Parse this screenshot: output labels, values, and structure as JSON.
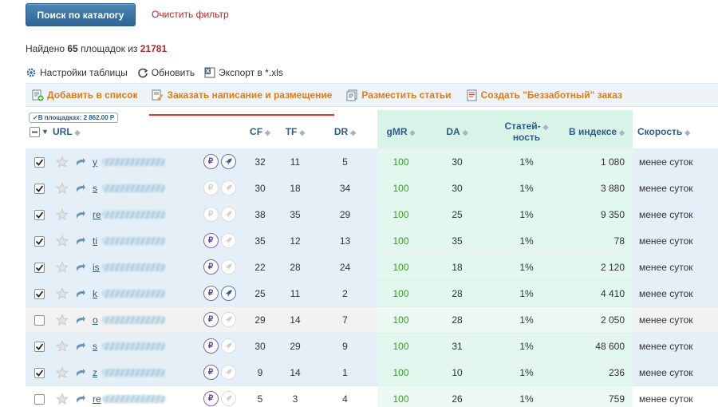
{
  "top": {
    "search_button": "Поиск по каталогу",
    "clear_filter": "Очистить фильтр"
  },
  "found": {
    "prefix": "Найдено",
    "count": "65",
    "middle": "площадок из",
    "total": "21781"
  },
  "tools": {
    "settings": "Настройки таблицы",
    "refresh": "Обновить",
    "export": "Экспорт в *.xls"
  },
  "actions": {
    "add_to_list": "Добавить в список",
    "order_writing": "Заказать написание и размещение",
    "place_articles": "Разместить статьи",
    "create_order": "Создать \"Беззаботный\" заказ"
  },
  "badge": "✓В площадках: 2 862.00 Р",
  "columns": {
    "url": "URL",
    "cf": "CF",
    "tf": "TF",
    "dr": "DR",
    "gmr": "gMR",
    "da": "DA",
    "articles_l1": "Статей-",
    "articles_l2": "ность",
    "index": "В индексе",
    "speed": "Скорость"
  },
  "rows": [
    {
      "checked": true,
      "prefix": "y",
      "ruble": "on",
      "rocket": "blue",
      "cf": "32",
      "tf": "11",
      "dr": "5",
      "gmr": "100",
      "da": "30",
      "st": "1%",
      "idx": "1 080",
      "speed": "менее суток"
    },
    {
      "checked": true,
      "prefix": "s",
      "ruble": "off",
      "rocket": "off",
      "cf": "30",
      "tf": "18",
      "dr": "34",
      "gmr": "100",
      "da": "30",
      "st": "1%",
      "idx": "3 880",
      "speed": "менее суток"
    },
    {
      "checked": true,
      "prefix": "re",
      "ruble": "off",
      "rocket": "off",
      "cf": "38",
      "tf": "35",
      "dr": "29",
      "gmr": "100",
      "da": "25",
      "st": "1%",
      "idx": "9 350",
      "speed": "менее суток"
    },
    {
      "checked": true,
      "prefix": "ti",
      "ruble": "on",
      "rocket": "off",
      "cf": "35",
      "tf": "12",
      "dr": "13",
      "gmr": "100",
      "da": "35",
      "st": "1%",
      "idx": "78",
      "speed": "менее суток"
    },
    {
      "checked": true,
      "prefix": "is",
      "ruble": "on",
      "rocket": "off",
      "cf": "22",
      "tf": "28",
      "dr": "24",
      "gmr": "100",
      "da": "18",
      "st": "1%",
      "idx": "2 120",
      "speed": "менее суток"
    },
    {
      "checked": true,
      "prefix": "k",
      "ruble": "on",
      "rocket": "blue",
      "cf": "25",
      "tf": "11",
      "dr": "2",
      "gmr": "100",
      "da": "28",
      "st": "1%",
      "idx": "4 410",
      "speed": "менее суток"
    },
    {
      "checked": false,
      "prefix": "o",
      "ruble": "on",
      "rocket": "off",
      "cf": "29",
      "tf": "14",
      "dr": "7",
      "gmr": "100",
      "da": "28",
      "st": "1%",
      "idx": "2 050",
      "speed": "менее суток"
    },
    {
      "checked": true,
      "prefix": "s",
      "ruble": "on",
      "rocket": "off",
      "cf": "30",
      "tf": "29",
      "dr": "9",
      "gmr": "100",
      "da": "31",
      "st": "1%",
      "idx": "48 600",
      "speed": "менее суток"
    },
    {
      "checked": true,
      "prefix": "z",
      "ruble": "on",
      "rocket": "off",
      "cf": "9",
      "tf": "14",
      "dr": "1",
      "gmr": "100",
      "da": "10",
      "st": "1%",
      "idx": "236",
      "speed": "менее суток"
    },
    {
      "checked": false,
      "prefix": "re",
      "ruble": "on",
      "rocket": "off",
      "cf": "5",
      "tf": "3",
      "dr": "4",
      "gmr": "100",
      "da": "26",
      "st": "1%",
      "idx": "759",
      "speed": "менее суток"
    }
  ],
  "colors": {
    "accent_orange": "#e47911",
    "link_blue": "#2f5c86",
    "red": "#b3262b",
    "green_text": "#3b9b2a"
  }
}
